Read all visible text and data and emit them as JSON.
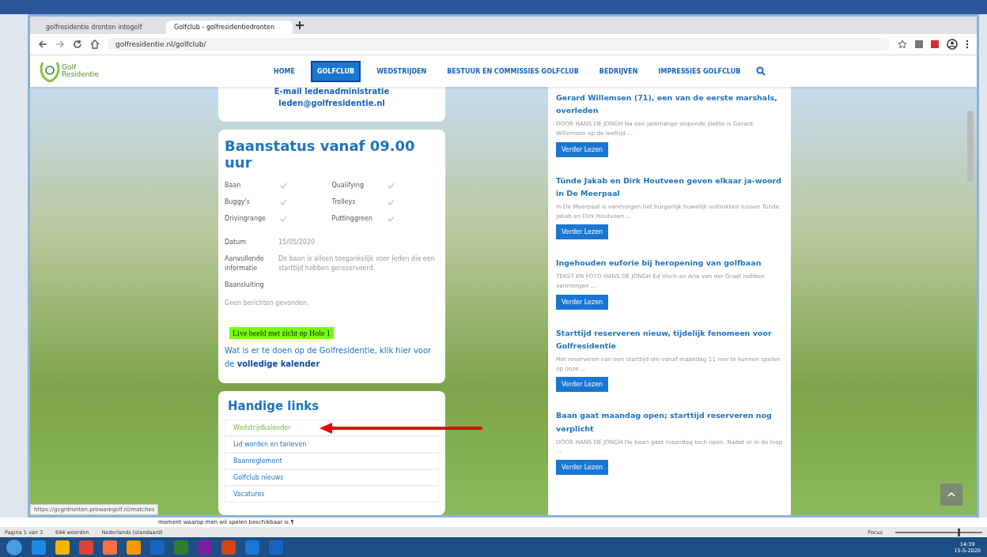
{
  "browser": {
    "tabs": [
      {
        "label": "golfresidentie dronten intogolf",
        "selected": false
      },
      {
        "label": "Golfclub - golfresidentiedronten",
        "selected": true
      }
    ],
    "address": "golfresidentie.nl/golfclub/"
  },
  "site": {
    "logo": {
      "name": "Golf",
      "sub": "Residentie"
    },
    "nav": [
      {
        "label": "HOME",
        "selected": false
      },
      {
        "label": "GOLFCLUB",
        "selected": true
      },
      {
        "label": "WEDSTRIJDEN",
        "selected": false
      },
      {
        "label": "BESTUUR EN COMMISSIES GOLFCLUB",
        "selected": false
      },
      {
        "label": "BEDRIJVEN",
        "selected": false
      },
      {
        "label": "IMPRESSIES GOLFCLUB",
        "selected": false
      }
    ]
  },
  "contact_card": {
    "lines": [
      "E-mail ledenadministratie",
      "leden@golfresidentie.nl"
    ]
  },
  "status_card": {
    "title": "Baanstatus vanaf 09.00 uur",
    "facilities": [
      {
        "label": "Baan",
        "checked": true
      },
      {
        "label": "Qualifying",
        "checked": true
      },
      {
        "label": "Buggy's",
        "checked": true
      },
      {
        "label": "Trolleys",
        "checked": true
      },
      {
        "label": "Drivingrange",
        "checked": true
      },
      {
        "label": "Puttinggreen",
        "checked": true
      }
    ],
    "details": [
      {
        "label": "Datum",
        "value": "15/05/2020"
      },
      {
        "label": "Aanvullende informatie",
        "value": "De baan is alleen toegankelijk voor leden die een starttijd hebben gereserveerd."
      },
      {
        "label": "Baansluiting"
      }
    ],
    "empty_note": "Geen berichten gevonden.",
    "live_link": "Live beeld met zicht op Hole 1",
    "calendar_text": "Wat is er te doen op de Golfresidentie, klik hier voor de **volledige kalender**"
  },
  "links_card": {
    "title": "Handige links",
    "links": [
      {
        "label": "Wedstrijdkalender",
        "highlighted": true
      },
      {
        "label": "Lid worden en tarieven",
        "highlighted": false
      },
      {
        "label": "Baanreglement",
        "highlighted": false
      },
      {
        "label": "Golfclub nieuws",
        "highlighted": false
      },
      {
        "label": "Vacatures",
        "highlighted": false
      }
    ]
  },
  "news": [
    {
      "title": "Gerard Willemsen (71), een van de eerste marshals, overleden",
      "excerpt": "DOOR HANS DE JONGH Na een jarenlange slopende ziekte is Gerard Willemsen op de leeftijd ...",
      "button": "Verder Lezen"
    },
    {
      "title": "Tünde Jakab en Dirk Houtveen geven elkaar ja-woord in De Meerpaal",
      "excerpt": "In De Meerpaal is vanmorgen het burgerlijk huwelijk voltrokken tussen Tünde Jakab en Dirk Houtveen ...",
      "button": "Verder Lezen"
    },
    {
      "title": "Ingehouden euforie bij heropening van golfbaan",
      "excerpt": "TEKST EN FOTO HANS DE JONGH Ed Visch en Arie van der Graaf hebben vanmorgen ...",
      "button": "Verder Lezen"
    },
    {
      "title": "Starttijd reserveren nieuw, tijdelijk fenomeen voor Golfresidentie",
      "excerpt": "Het reserveren van een starttijd om vanaf maandag 11 mei te kunnen spelen op onze ...",
      "button": "Verder Lezen"
    },
    {
      "title": "Baan gaat maandag open; starttijd reserveren nog verplicht",
      "excerpt": "DOOR HANS DE JONGH De baan gaat maandag toch open. Nadat er in de loop ...",
      "button": "Verder Lezen"
    }
  ],
  "link_status_url": "https://gcgrdronten.prowaregolf.nl/matches",
  "word": {
    "doc_line": "moment waarop men wil spelen beschikbaar is.¶",
    "page": "Pagina 1 van 3",
    "words": "694 woorden",
    "language": "Nederlands (standaard)",
    "focus": "Focus",
    "zoom": {
      "level": 0.72
    }
  },
  "taskbar": {
    "time": "14:39",
    "date": "15-5-2020"
  }
}
